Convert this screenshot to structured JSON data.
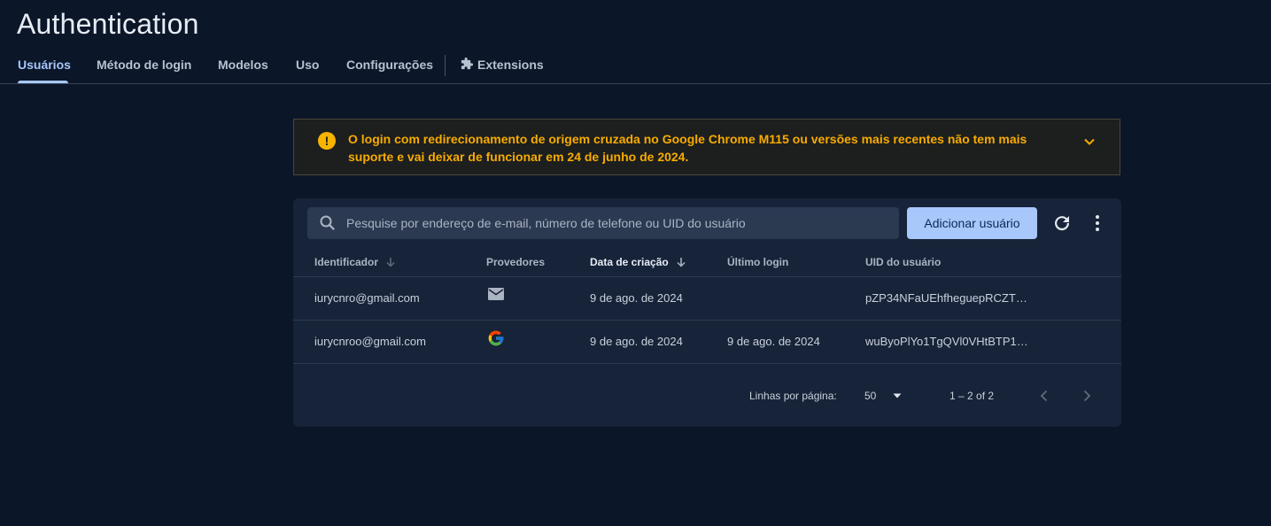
{
  "header": {
    "title": "Authentication"
  },
  "tabs": [
    {
      "label": "Usuários",
      "active": true
    },
    {
      "label": "Método de login"
    },
    {
      "label": "Modelos"
    },
    {
      "label": "Uso"
    },
    {
      "label": "Configurações"
    },
    {
      "label": "Extensions",
      "icon": "extensions-icon"
    }
  ],
  "banner": {
    "icon": "warning-icon",
    "text": "O login com redirecionamento de origem cruzada no Google Chrome M115 ou versões mais recentes não tem mais suporte e vai deixar de funcionar em 24 de junho de 2024.",
    "color": "#f9ab00"
  },
  "toolbar": {
    "search_placeholder": "Pesquise por endereço de e-mail, número de telefone ou UID do usuário",
    "search_value": "",
    "add_user_label": "Adicionar usuário",
    "accent": "#a8c7fa"
  },
  "table": {
    "columns": [
      "Identificador",
      "Provedores",
      "Data de criação",
      "Último login",
      "UID do usuário"
    ],
    "sorted_column": "Data de criação",
    "rows": [
      {
        "identifier": "iurycnro@gmail.com",
        "provider": "email-icon",
        "created": "9 de ago. de 2024",
        "last_login": "",
        "uid": "pZP34NFaUEhfheguepRCZT0…"
      },
      {
        "identifier": "iurycnroo@gmail.com",
        "provider": "google-icon",
        "created": "9 de ago. de 2024",
        "last_login": "9 de ago. de 2024",
        "uid": "wuByoPlYo1TgQVl0VHtBTP1G…"
      }
    ]
  },
  "pagination": {
    "rows_per_page_label": "Linhas por página:",
    "rows_per_page_value": "50",
    "range": "1 – 2 of 2"
  }
}
